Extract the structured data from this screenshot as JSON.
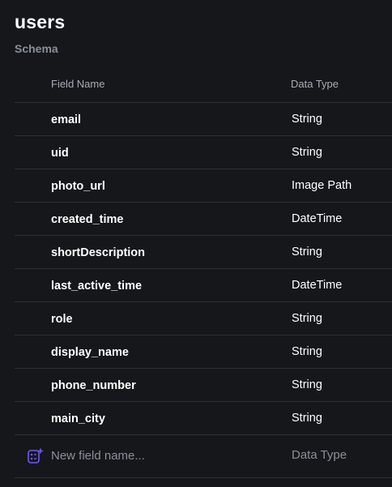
{
  "collection": {
    "title": "users",
    "subtitle": "Schema"
  },
  "table": {
    "headers": {
      "field_name": "Field Name",
      "data_type": "Data Type"
    },
    "rows": [
      {
        "name": "email",
        "type": "String"
      },
      {
        "name": "uid",
        "type": "String"
      },
      {
        "name": "photo_url",
        "type": "Image Path"
      },
      {
        "name": "created_time",
        "type": "DateTime"
      },
      {
        "name": "shortDescription",
        "type": "String"
      },
      {
        "name": "last_active_time",
        "type": "DateTime"
      },
      {
        "name": "role",
        "type": "String"
      },
      {
        "name": "display_name",
        "type": "String"
      },
      {
        "name": "phone_number",
        "type": "String"
      },
      {
        "name": "main_city",
        "type": "String"
      }
    ],
    "new_field": {
      "icon": "add-field-icon",
      "name_placeholder": "New field name...",
      "type_placeholder": "Data Type"
    }
  },
  "colors": {
    "background": "#15171b",
    "accent": "#6e5bf0",
    "muted_text": "#8a9099",
    "divider": "#2c3036"
  }
}
